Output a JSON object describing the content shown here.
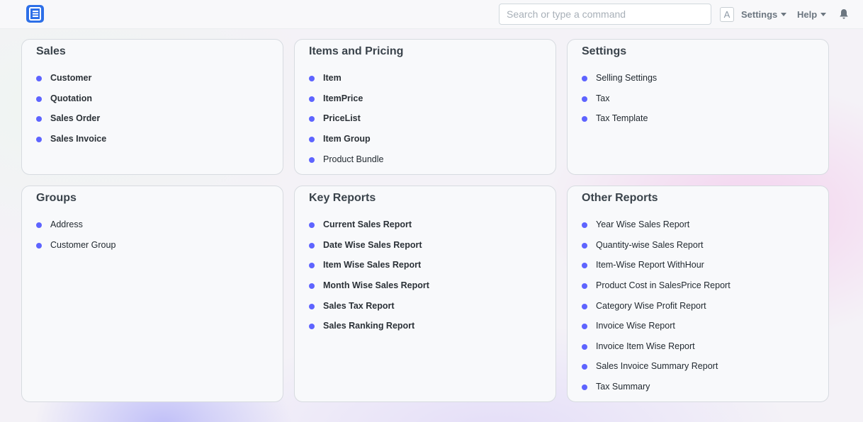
{
  "navbar": {
    "search_placeholder": "Search or type a command",
    "shortcut_key": "A",
    "settings_label": "Settings",
    "help_label": "Help",
    "logo_icon": "app-logo-icon",
    "notification_icon": "bell-icon"
  },
  "colors": {
    "accent_dot": "#5e64ff",
    "logo": "#2d6fe8"
  },
  "cards": {
    "sales": {
      "title": "Sales",
      "items": [
        "Customer",
        "Quotation",
        "Sales Order",
        "Sales Invoice"
      ]
    },
    "items_pricing": {
      "title": "Items and Pricing",
      "items": [
        "Item",
        "ItemPrice",
        "PriceList",
        "Item Group",
        "Product Bundle"
      ]
    },
    "settings": {
      "title": "Settings",
      "items": [
        "Selling Settings",
        "Tax",
        "Tax Template"
      ]
    },
    "groups": {
      "title": "Groups",
      "items": [
        "Address",
        "Customer Group"
      ]
    },
    "key_reports": {
      "title": "Key Reports",
      "items": [
        "Current Sales Report",
        "Date Wise Sales Report",
        "Item Wise Sales Report",
        "Month Wise Sales Report",
        "Sales Tax Report",
        "Sales Ranking Report"
      ]
    },
    "other_reports": {
      "title": "Other Reports",
      "items": [
        "Year Wise Sales Report",
        "Quantity-wise Sales Report",
        "Item-Wise Report WithHour",
        "Product Cost in SalesPrice Report",
        "Category Wise Profit Report",
        "Invoice Wise Report",
        "Invoice Item Wise Report",
        "Sales Invoice Summary Report",
        "Tax Summary"
      ]
    }
  }
}
